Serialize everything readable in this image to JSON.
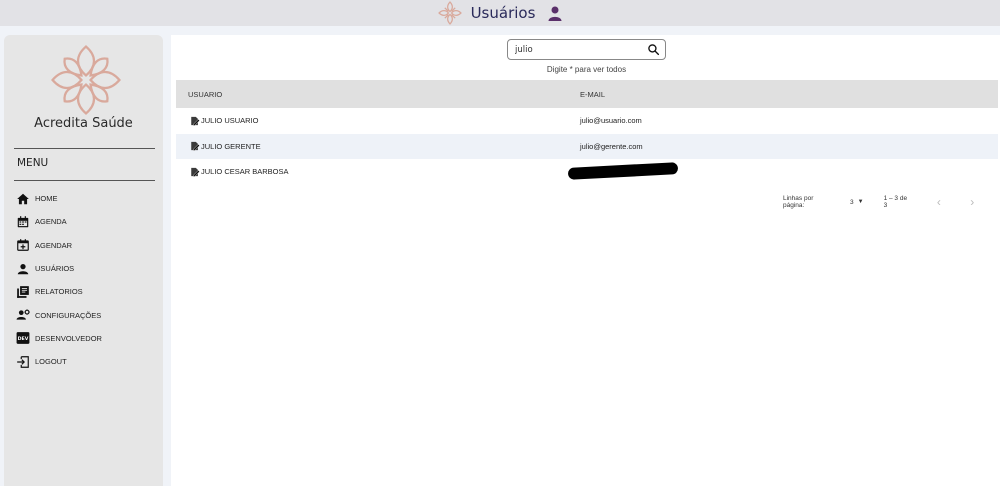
{
  "header": {
    "title": "Usuários",
    "logo_icon": "cross-flower-logo-icon",
    "user_icon": "person-icon"
  },
  "colors": {
    "accent": "#d9a99c",
    "title_text": "#2a2a5a",
    "user_icon": "#5a2f6a"
  },
  "sidebar": {
    "brand": "Acredita Saúde",
    "menu_title": "MENU",
    "items": [
      {
        "label": "HOME",
        "icon": "home-icon"
      },
      {
        "label": "AGENDA",
        "icon": "calendar-icon"
      },
      {
        "label": "AGENDAR",
        "icon": "calendar-add-icon"
      },
      {
        "label": "USUÁRIOS",
        "icon": "person-icon"
      },
      {
        "label": "RELATORIOS",
        "icon": "reports-icon"
      },
      {
        "label": "CONFIGURAÇÕES",
        "icon": "user-settings-icon"
      },
      {
        "label": "DESENVOLVEDOR",
        "icon": "dev-icon"
      },
      {
        "label": "LOGOUT",
        "icon": "logout-icon"
      }
    ]
  },
  "search": {
    "value": "julio",
    "hint": "Digite * para ver todos"
  },
  "table": {
    "columns": [
      "USUARIO",
      "E-MAIL"
    ],
    "rows": [
      {
        "name": "JULIO USUARIO",
        "email": "julio@usuario.com"
      },
      {
        "name": "JULIO GERENTE",
        "email": "julio@gerente.com"
      },
      {
        "name": "JULIO CESAR BARBOSA",
        "email": ""
      }
    ]
  },
  "pagination": {
    "rows_label": "Linhas por página:",
    "rows_per_page": "3",
    "range": "1 – 3 de 3"
  }
}
